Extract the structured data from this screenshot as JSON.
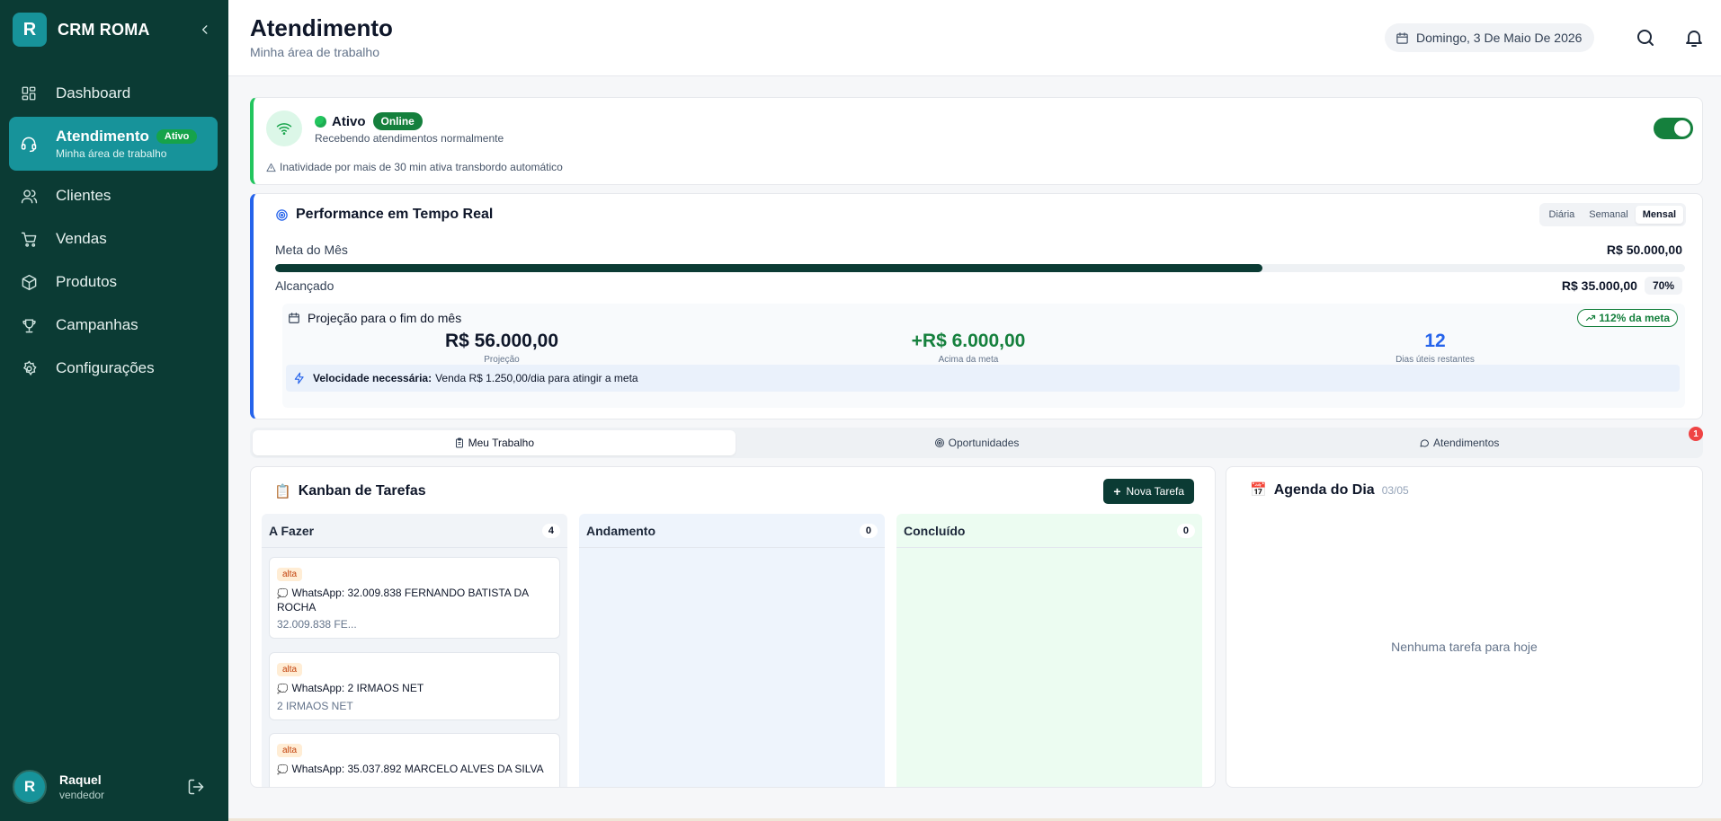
{
  "sidebar": {
    "brand_initial": "R",
    "brand_name": "CRM ROMA",
    "items": [
      {
        "label": "Dashboard",
        "icon": "grid-icon"
      },
      {
        "label": "Atendimento",
        "icon": "headset-icon",
        "badge": "Ativo",
        "sub": "Minha área de trabalho"
      },
      {
        "label": "Clientes",
        "icon": "users-icon"
      },
      {
        "label": "Vendas",
        "icon": "cart-icon"
      },
      {
        "label": "Produtos",
        "icon": "box-icon"
      },
      {
        "label": "Campanhas",
        "icon": "trophy-icon"
      },
      {
        "label": "Configurações",
        "icon": "gear-icon"
      }
    ],
    "user": {
      "initial": "R",
      "name": "Raquel",
      "role": "vendedor"
    }
  },
  "header": {
    "title": "Atendimento",
    "subtitle": "Minha área de trabalho",
    "date": "Domingo, 3 De Maio De 2026"
  },
  "status": {
    "label": "Ativo",
    "badge": "Online",
    "sub": "Recebendo atendimentos normalmente",
    "warning": "Inatividade por mais de 30 min ativa transbordo automático",
    "toggle_on": true
  },
  "performance": {
    "title": "Performance em Tempo Real",
    "periods": [
      "Diária",
      "Semanal",
      "Mensal"
    ],
    "active_period": "Mensal",
    "meta_label": "Meta do Mês",
    "meta_value": "R$ 50.000,00",
    "progress": 0.7,
    "achieved_label": "Alcançado",
    "achieved_value": "R$ 35.000,00",
    "achieved_pct": "70%",
    "projection": {
      "title": "Projeção para o fim do mês",
      "badge": "112% da meta",
      "stats": [
        {
          "value": "R$ 56.000,00",
          "label": "Projeção",
          "color": "#0f172a"
        },
        {
          "value": "+R$ 6.000,00",
          "label": "Acima da meta",
          "color": "#15803d"
        },
        {
          "value": "12",
          "label": "Dias úteis restantes",
          "color": "#2563eb"
        }
      ],
      "velocity_label": "Velocidade necessária:",
      "velocity_text": "Venda R$ 1.250,00/dia para atingir a meta"
    }
  },
  "tabs": [
    {
      "label": "Meu Trabalho",
      "icon": "clipboard-icon"
    },
    {
      "label": "Oportunidades",
      "icon": "target-icon"
    },
    {
      "label": "Atendimentos",
      "icon": "chat-icon"
    }
  ],
  "tabs_notification": "1",
  "kanban": {
    "emoji": "📋",
    "title": "Kanban de Tarefas",
    "new_button": "Nova Tarefa",
    "columns": [
      {
        "name": "A Fazer",
        "count": "4",
        "bg": "#f1f4f8"
      },
      {
        "name": "Andamento",
        "count": "0",
        "bg": "#eef4fc"
      },
      {
        "name": "Concluído",
        "count": "0",
        "bg": "#ecfcf1"
      }
    ],
    "tasks": [
      {
        "priority": "alta",
        "title": "WhatsApp: 32.009.838 FERNANDO BATISTA DA ROCHA",
        "desc": "32.009.838 FE..."
      },
      {
        "priority": "alta",
        "title": "WhatsApp: 2 IRMAOS NET",
        "desc": "2 IRMAOS NET"
      },
      {
        "priority": "alta",
        "title": "WhatsApp: 35.037.892 MARCELO ALVES DA SILVA",
        "desc": ""
      }
    ]
  },
  "agenda": {
    "emoji": "📅",
    "title": "Agenda do Dia",
    "date": "03/05",
    "empty": "Nenhuma tarefa para hoje"
  }
}
